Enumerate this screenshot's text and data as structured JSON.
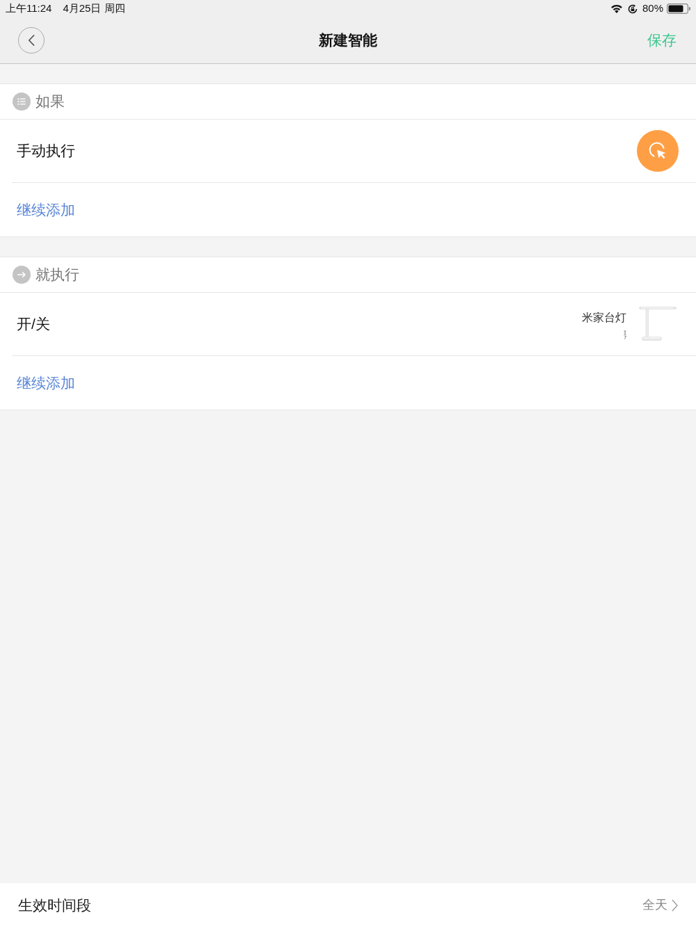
{
  "status_bar": {
    "time": "上午11:24",
    "date": "4月25日 周四",
    "battery": "80%"
  },
  "nav": {
    "title": "新建智能",
    "action": "保存"
  },
  "sections": [
    {
      "kind": "condition",
      "title": "如果",
      "items": [
        {
          "kind": "manual",
          "label": "手动执行"
        }
      ],
      "add_label": "继续添加"
    },
    {
      "kind": "action",
      "title": "就执行",
      "items": [
        {
          "kind": "device",
          "label": "开/关",
          "device": "米家台灯"
        }
      ],
      "add_label": "继续添加"
    }
  ],
  "footer": {
    "label": "生效时间段",
    "value": "全天"
  }
}
